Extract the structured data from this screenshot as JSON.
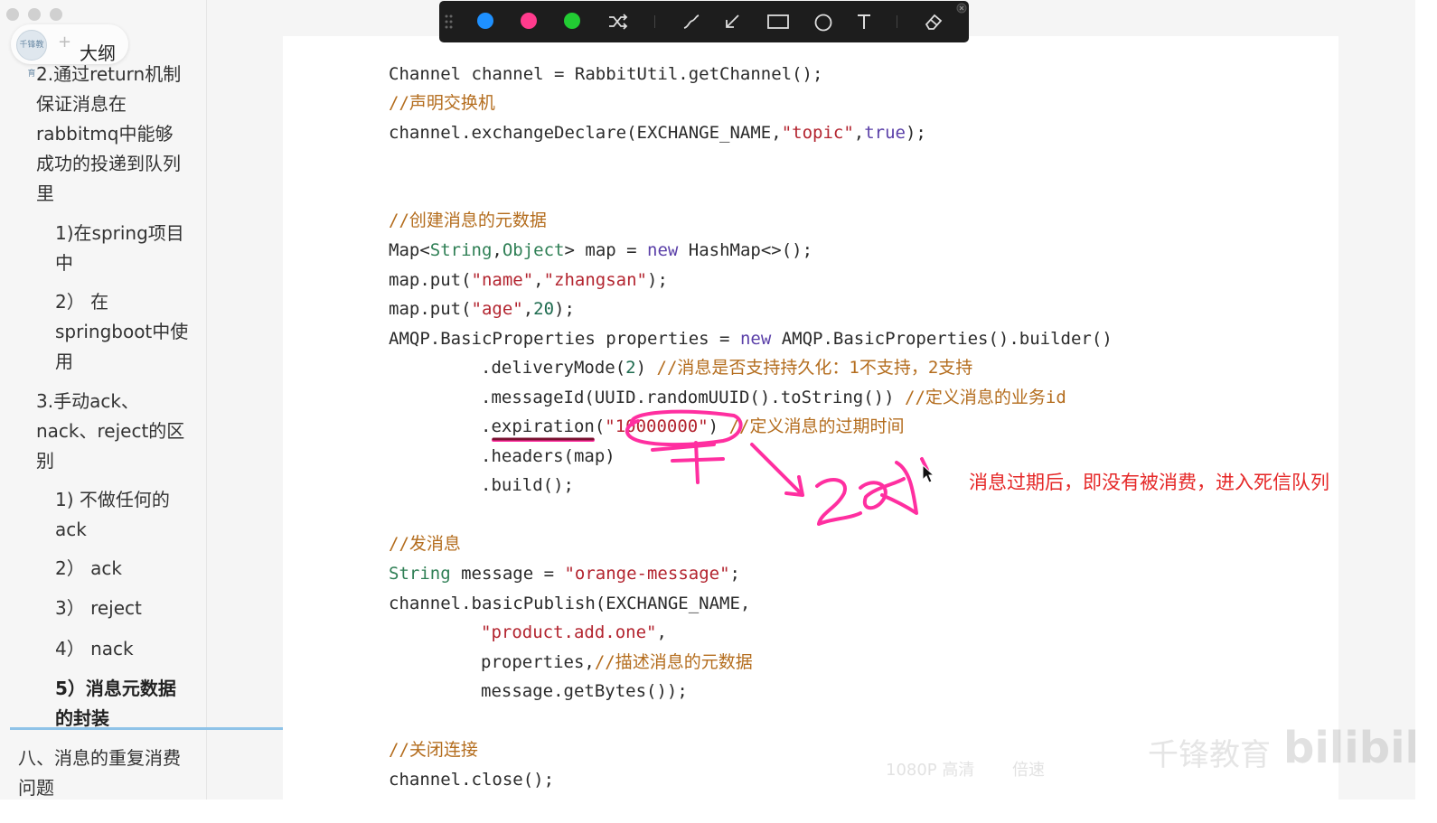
{
  "window": {
    "traffic_lights": [
      "close",
      "minimize",
      "zoom"
    ]
  },
  "sidebar": {
    "outline_label": "大纲",
    "outline_add": "+",
    "outline_avatar": "千锋教育",
    "items": [
      {
        "text": "2.通过return机制保证消息在rabbitmq中能够成功的投递到队列里",
        "level": 1
      },
      {
        "text": "1)在spring项目中",
        "level": 2
      },
      {
        "text": "2） 在springboot中使用",
        "level": 2
      },
      {
        "text": "3.手动ack、nack、reject的区别",
        "level": 1
      },
      {
        "text": "1) 不做任何的ack",
        "level": 2
      },
      {
        "text": "2） ack",
        "level": 2
      },
      {
        "text": "3） reject",
        "level": 2
      },
      {
        "text": "4） nack",
        "level": 2
      },
      {
        "text": "5）消息元数据的封装",
        "level": 2,
        "active": true
      },
      {
        "text": "八、消息的重复消费问题",
        "level": 0
      }
    ]
  },
  "toolbar": {
    "colors": [
      "#1e90ff",
      "#ff3b8d",
      "#22cc33"
    ],
    "tools": [
      "shuffle-icon",
      "pen-icon",
      "arrow-icon",
      "rectangle-icon",
      "circle-icon",
      "text-icon",
      "eraser-icon"
    ]
  },
  "code": {
    "l1": "Channel channel = RabbitUtil.getChannel();",
    "l2": "//声明交换机",
    "l3a": "channel.exchangeDeclare(EXCHANGE_NAME,",
    "l3b": "\"topic\"",
    "l3c": ",",
    "l3d": "true",
    "l3e": ");",
    "l4": "//创建消息的元数据",
    "l5a": "Map<",
    "l5b": "String",
    "l5c": ",",
    "l5d": "Object",
    "l5e": "> map = ",
    "l5f": "new",
    "l5g": " HashMap<>();",
    "l6a": "map.put(",
    "l6b": "\"name\"",
    "l6c": ",",
    "l6d": "\"zhangsan\"",
    "l6e": ");",
    "l7a": "map.put(",
    "l7b": "\"age\"",
    "l7c": ",",
    "l7d": "20",
    "l7e": ");",
    "l8a": "AMQP.BasicProperties properties = ",
    "l8b": "new",
    "l8c": " AMQP.BasicProperties().builder()",
    "l9a": ".deliveryMode(",
    "l9b": "2",
    "l9c": ") ",
    "l9d": "//消息是否支持持久化：1不支持，2支持",
    "l10a": ".messageId(UUID.randomUUID().toString()) ",
    "l10b": "//定义消息的业务id",
    "l11a": ".expiration(",
    "l11b": "\"10000000\"",
    "l11c": ") ",
    "l11d": "//定义消息的过期时间",
    "l12": ".headers(map)",
    "l13": ".build();",
    "l14": "//发消息",
    "l15a": "String",
    "l15b": " message = ",
    "l15c": "\"orange-message\"",
    "l15d": ";",
    "l16": "channel.basicPublish(EXCHANGE_NAME,",
    "l17a": "\"product.add.one\"",
    "l17b": ",",
    "l18a": "properties,",
    "l18b": "//描述消息的元数据",
    "l19": "message.getBytes());",
    "l20": "//关闭连接",
    "l21": "channel.close();"
  },
  "annotation": {
    "text": "消息过期后，即没有被消费，进入死信队列",
    "color": "#e52828",
    "handwriting_color": "#ff2fa0"
  },
  "watermark": {
    "brand": "千锋教育",
    "site": "bilibili"
  },
  "player": {
    "quality": "1080P 高清",
    "speed": "倍速"
  }
}
